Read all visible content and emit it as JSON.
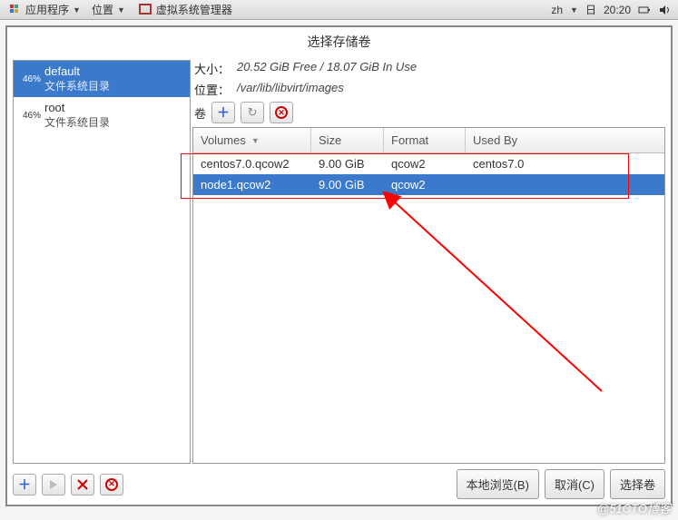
{
  "panel": {
    "apps_label": "应用程序",
    "places_label": "位置",
    "vm_title": "虚拟系统管理器",
    "lang": "zh",
    "weekday": "日",
    "time": "20:20"
  },
  "dialog": {
    "title": "选择存储卷",
    "pools": [
      {
        "pct": "46%",
        "name": "default",
        "sub": "文件系统目录",
        "selected": true
      },
      {
        "pct": "46%",
        "name": "root",
        "sub": "文件系统目录",
        "selected": false
      }
    ],
    "size_label": "大小：",
    "size_free": "20.52 GiB Free",
    "size_sep": "/",
    "size_inuse": "18.07 GiB In Use",
    "location_label": "位置：",
    "location_val": "/var/lib/libvirt/images",
    "vol_label": "卷",
    "columns": {
      "volumes": "Volumes",
      "size": "Size",
      "format": "Format",
      "usedby": "Used By"
    },
    "rows": [
      {
        "name": "centos7.0.qcow2",
        "size": "9.00 GiB",
        "format": "qcow2",
        "usedby": "centos7.0",
        "selected": false
      },
      {
        "name": "node1.qcow2",
        "size": "9.00 GiB",
        "format": "qcow2",
        "usedby": "",
        "selected": true
      }
    ],
    "buttons": {
      "browse_local": "本地浏览(B)",
      "cancel": "取消(C)",
      "choose": "选择卷"
    }
  },
  "watermark": "@51CTO博客"
}
